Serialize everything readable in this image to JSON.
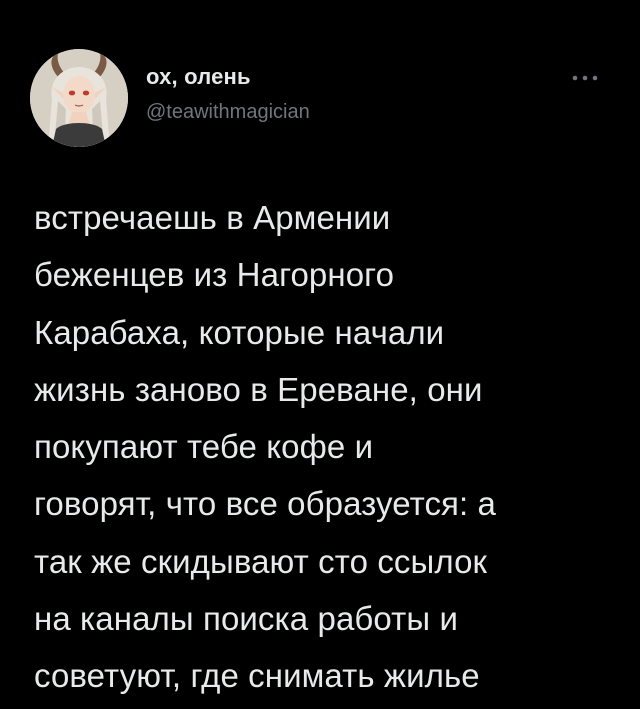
{
  "author": {
    "display_name": "ох, олень",
    "handle": "@teawithmagician"
  },
  "icons": {
    "more": "more-horizontal-icon",
    "avatar": "avatar-image"
  },
  "tweet": {
    "text": "встречаешь в Армении\nбеженцев из Нагорного\nКарабаха, которые начали\nжизнь заново в Ереване, они\nпокупают тебе кофе и\nговорят, что все образуется: а\nтак же скидывают сто ссылок\nна каналы поиска работы и\nсоветуют, где снимать жилье"
  },
  "colors": {
    "background": "#000000",
    "text_primary": "#e7e9ea",
    "text_secondary": "#71767b"
  }
}
